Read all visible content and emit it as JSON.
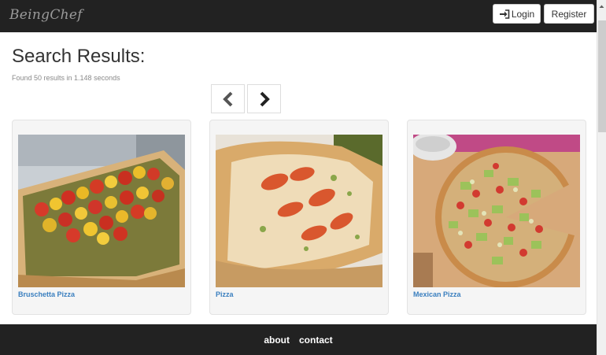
{
  "brand": "BeingChef",
  "nav": {
    "login_label": "Login",
    "register_label": "Register"
  },
  "main": {
    "title": "Search Results:",
    "results_meta": "Found 50 results in 1.148 seconds"
  },
  "cards": [
    {
      "title": "Bruschetta Pizza",
      "image": "bruschetta-pizza-photo"
    },
    {
      "title": "Pizza",
      "image": "pizza-photo"
    },
    {
      "title": "Mexican Pizza",
      "image": "mexican-pizza-photo"
    }
  ],
  "footer": {
    "about_label": "about",
    "contact_label": "contact"
  },
  "colors": {
    "navbar": "#222222",
    "link": "#3a7fbf",
    "card_bg": "#f5f5f5"
  }
}
